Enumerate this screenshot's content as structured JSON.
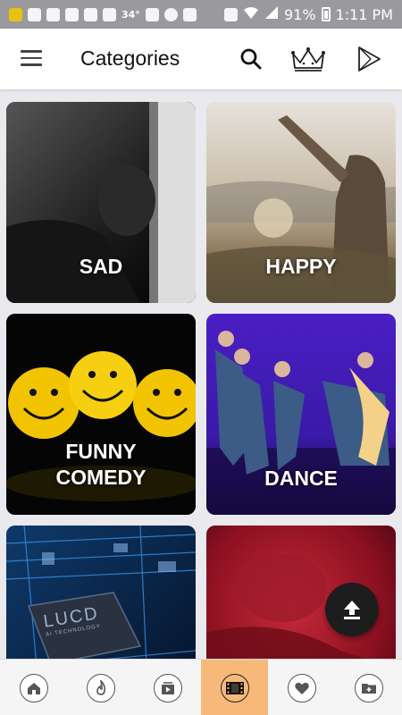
{
  "status_bar": {
    "temperature": "34°",
    "battery": "91%",
    "time": "1:11 PM"
  },
  "app_bar": {
    "title": "Categories"
  },
  "categories": [
    {
      "label": "SAD"
    },
    {
      "label": "HAPPY"
    },
    {
      "label": "FUNNY\nCOMEDY"
    },
    {
      "label": "DANCE"
    },
    {
      "label": ""
    },
    {
      "label": ""
    }
  ],
  "tech_card": {
    "logo_text": "LUCD",
    "logo_sub": "AI TECHNOLOGY"
  },
  "bottom_nav": {
    "items": [
      "home-icon",
      "fire-icon",
      "video-library-icon",
      "film-strip-icon",
      "heart-icon",
      "add-folder-icon"
    ],
    "active_index": 3,
    "active_color": "#f6b97a"
  }
}
